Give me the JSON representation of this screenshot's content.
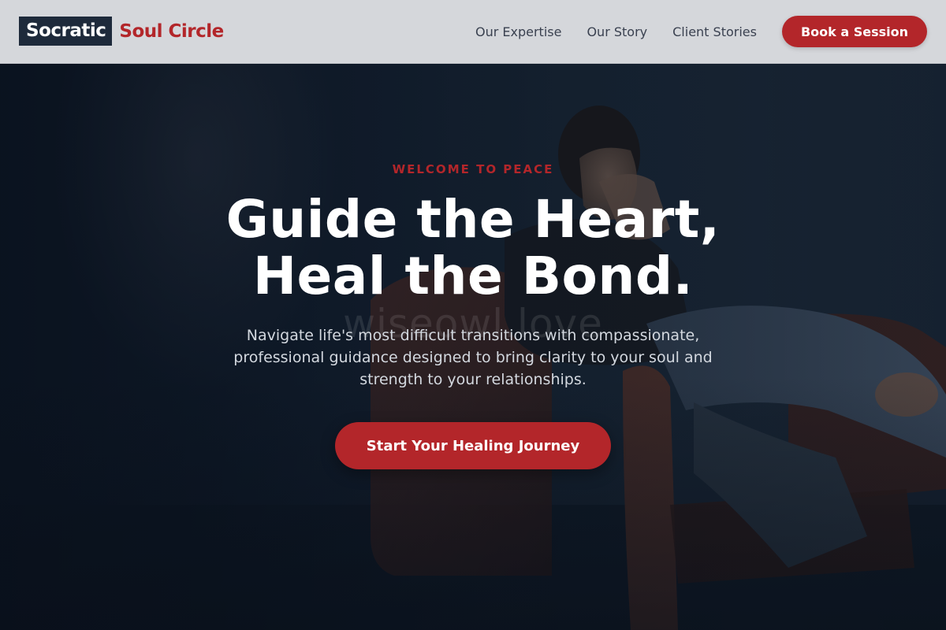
{
  "brand": {
    "name_box": "Socratic",
    "name_accent": "Soul Circle"
  },
  "nav": {
    "items": [
      {
        "label": "Our Expertise"
      },
      {
        "label": "Our Story"
      },
      {
        "label": "Client Stories"
      }
    ],
    "cta_label": "Book a Session"
  },
  "hero": {
    "eyebrow": "WELCOME TO PEACE",
    "headline_line1": "Guide the Heart,",
    "headline_line2": "Heal the Bond.",
    "subtext": "Navigate life's most difficult transitions with compassionate, professional guidance designed to bring clarity to your soul and strength to your relationships.",
    "cta_label": "Start Your Healing Journey",
    "watermark": "wiseowl.love",
    "photo_subject": "person sitting in leather armchair"
  },
  "colors": {
    "accent": "#b3262a",
    "header_bg": "#d5d7db",
    "logo_box_bg": "#1e2a3b",
    "hero_bg": "#142335"
  }
}
